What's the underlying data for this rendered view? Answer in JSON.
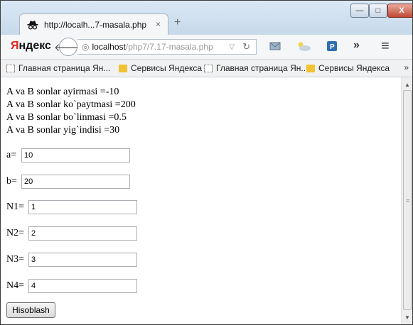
{
  "tab": {
    "title": "http://localh...7-masala.php",
    "close": "×",
    "new": "+"
  },
  "window_controls": {
    "minimize": "—",
    "maximize": "□",
    "close": "X"
  },
  "navbar": {
    "logo_first": "Я",
    "logo_rest": "ндекс",
    "url_host": "localhost",
    "url_path": "/php7/7.17-masala.php",
    "overflow": "»",
    "menu": "≡"
  },
  "bookmarks": [
    {
      "label": "Главная страница Ян...",
      "icon": "page"
    },
    {
      "label": "Сервисы Яндекса",
      "icon": "folder"
    },
    {
      "label": "Главная страница Ян...",
      "icon": "page"
    },
    {
      "label": "Сервисы Яндекса",
      "icon": "folder"
    }
  ],
  "bookmarks_more": "»",
  "page": {
    "results": [
      "A va B sonlar ayirmasi =-10",
      "A va B sonlar ko`paytmasi =200",
      "A va B sonlar bo`linmasi =0.5",
      "A va B sonlar yig`indisi =30"
    ],
    "fields": [
      {
        "label": "a=",
        "value": "10"
      },
      {
        "label": "b=",
        "value": "20"
      },
      {
        "label": "N1=",
        "value": "1"
      },
      {
        "label": "N2=",
        "value": "2"
      },
      {
        "label": "N3=",
        "value": "3"
      },
      {
        "label": "N4=",
        "value": "4"
      }
    ],
    "submit_label": "Hisoblash"
  }
}
